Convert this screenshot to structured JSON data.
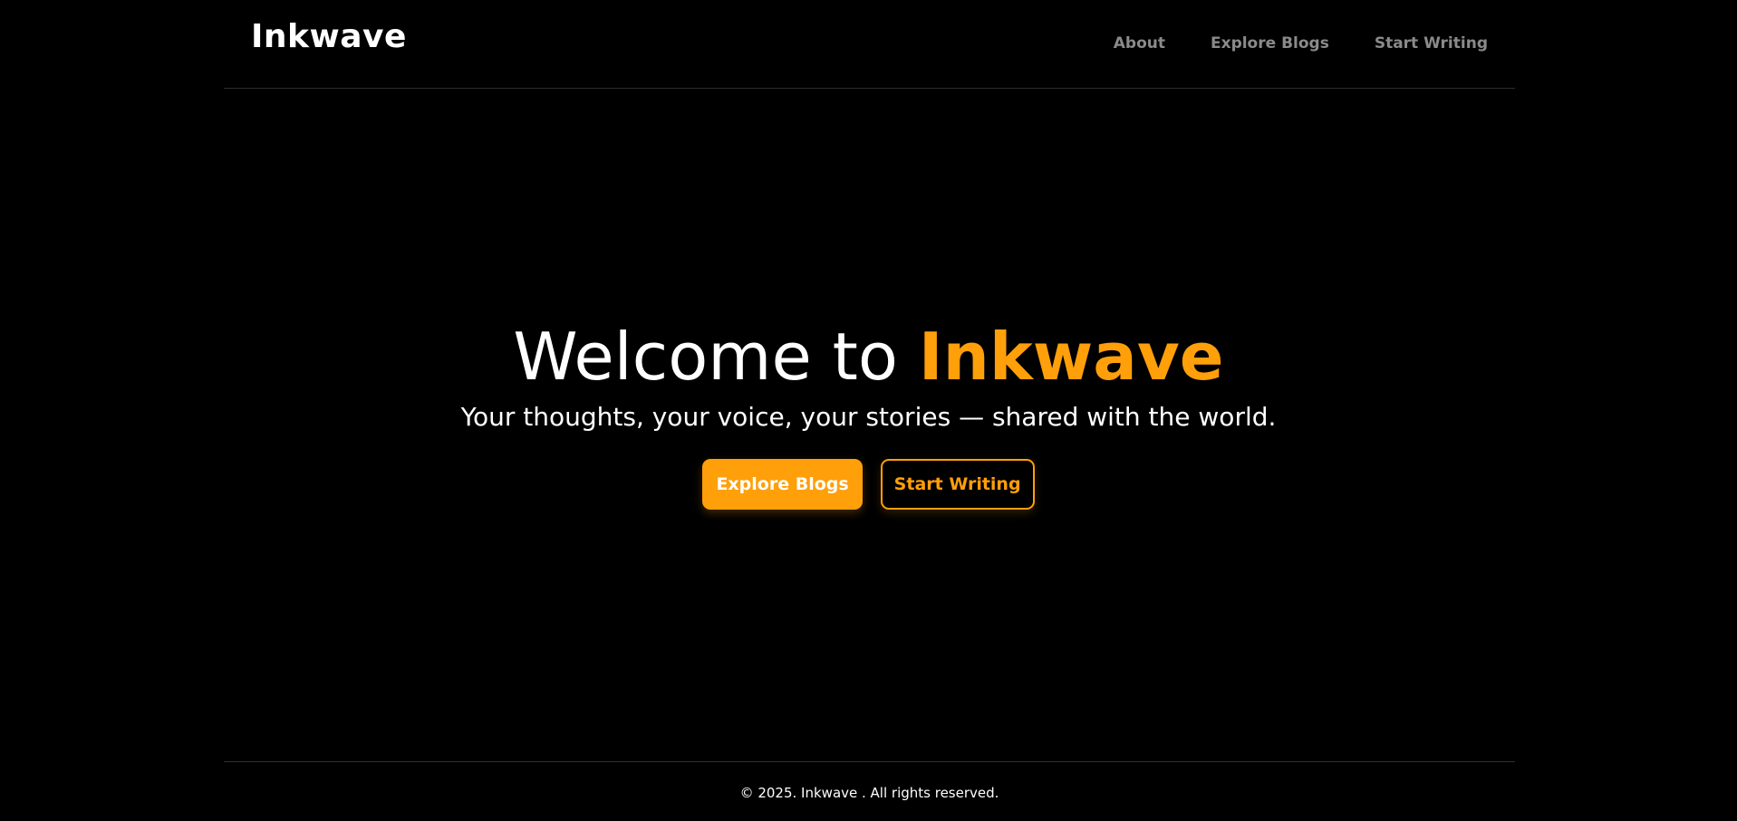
{
  "header": {
    "logo": "Inkwave",
    "nav": [
      {
        "label": "About"
      },
      {
        "label": "Explore Blogs"
      },
      {
        "label": "Start Writing"
      }
    ]
  },
  "hero": {
    "title_prefix": "Welcome to ",
    "title_brand": "Inkwave",
    "subtitle": "Your thoughts, your voice, your stories — shared with the world.",
    "primary_button": "Explore Blogs",
    "secondary_button": "Start Writing"
  },
  "footer": {
    "copyright": "© 2025. Inkwave . All rights reserved."
  },
  "colors": {
    "background": "#000000",
    "accent": "#ff9f0a",
    "nav_text": "#8a8a8a",
    "divider": "#2e2e2e"
  }
}
